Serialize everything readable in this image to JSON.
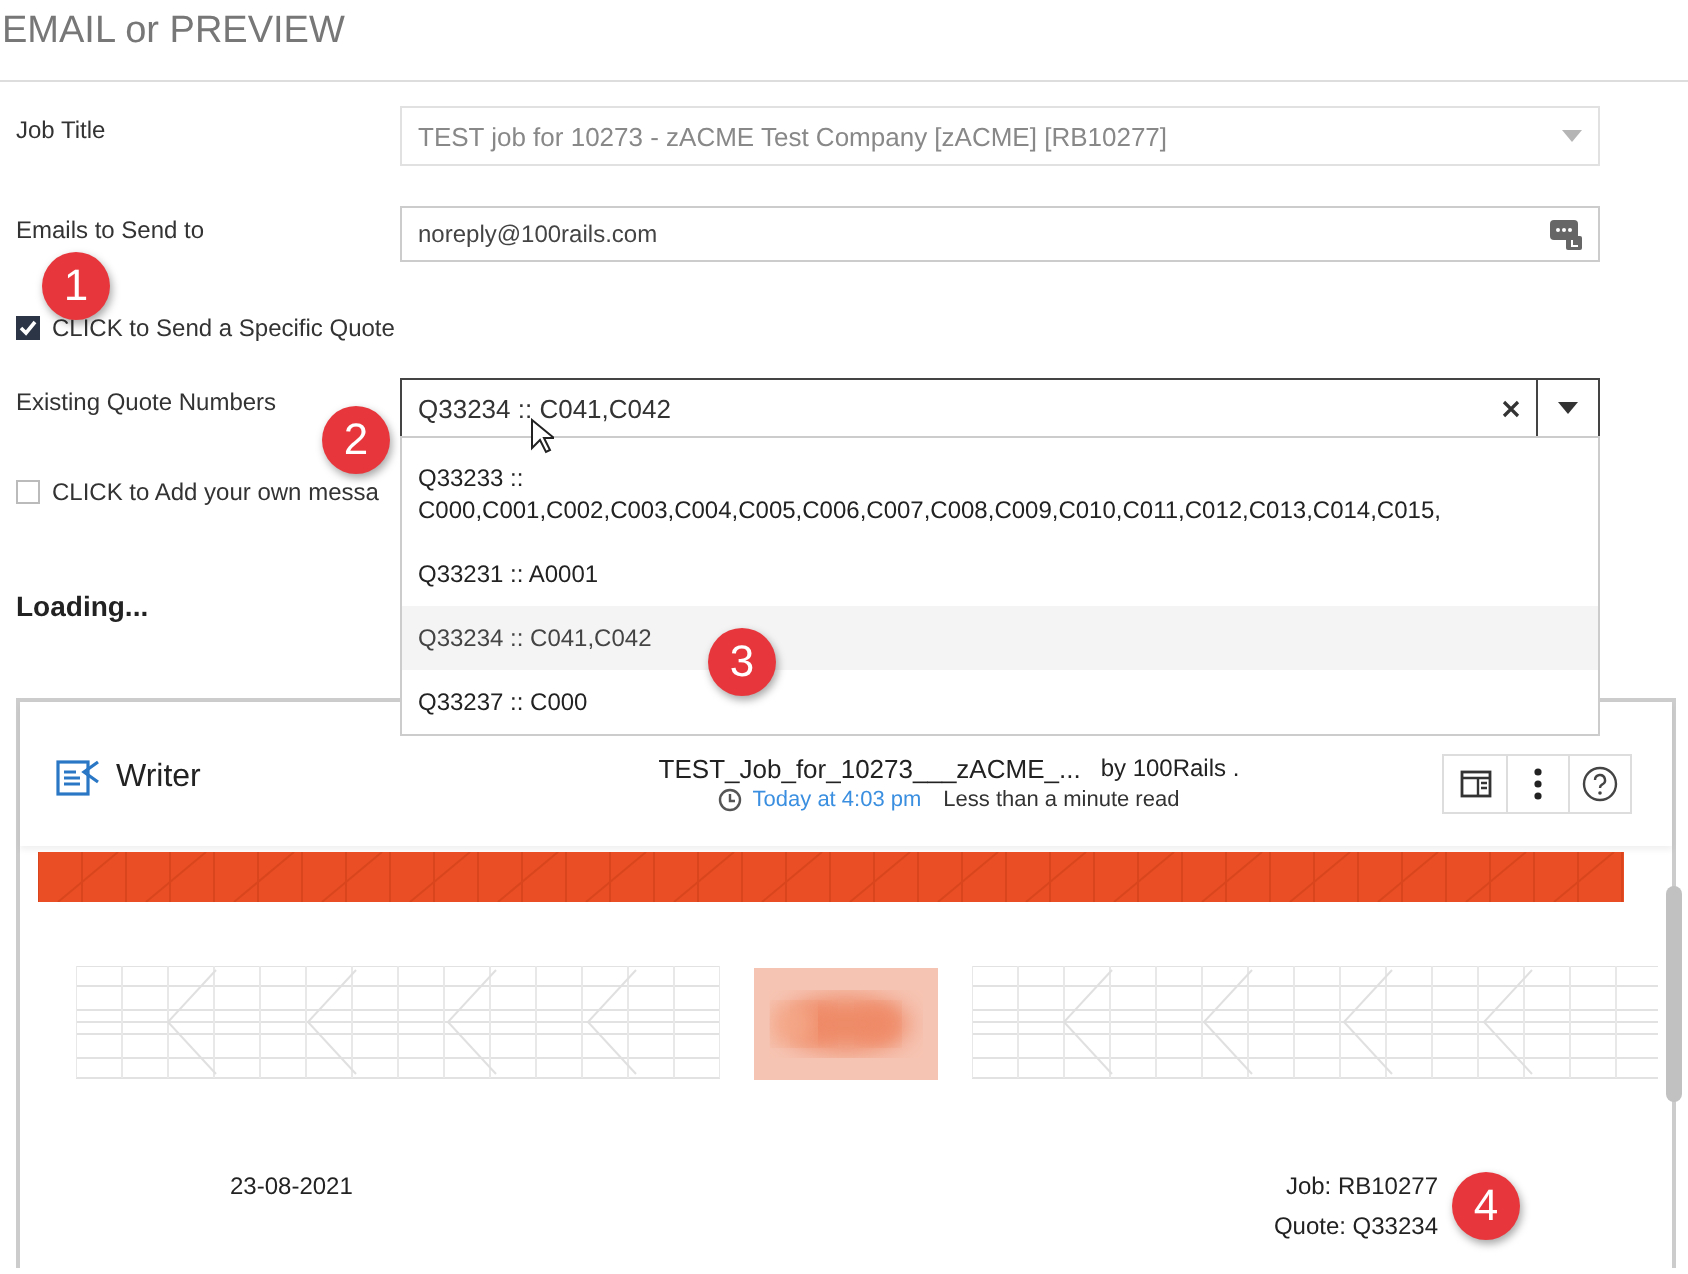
{
  "page": {
    "title": "EMAIL or PREVIEW"
  },
  "fields": [
    {
      "kind": "select",
      "label": "Job Title",
      "value": "TEST job for 10273 - zACME Test Company [zACME] [RB10277]",
      "disabled": true
    },
    {
      "kind": "email",
      "label": "Emails to Send to",
      "value": "noreply@100rails.com",
      "disabled": false
    }
  ],
  "specific_quote": {
    "label": "CLICK to Send a Specific Quote",
    "checked": true
  },
  "quote_select": {
    "label": "Existing Quote Numbers",
    "value": "Q33234 :: C041,C042",
    "expanded": true,
    "options": [
      {
        "text": "Q33233 :: C000,C001,C002,C003,C004,C005,C006,C007,C008,C009,C010,C011,C012,C013,C014,C015,",
        "selected": false
      },
      {
        "text": "Q33231 :: A0001",
        "selected": false
      },
      {
        "text": "Q33234 :: C041,C042",
        "selected": true
      },
      {
        "text": "Q33237 :: C000",
        "selected": false
      }
    ]
  },
  "own_message": {
    "label": "CLICK to Add your own messa",
    "checked": false
  },
  "status": "Loading...",
  "preview": {
    "app": "Writer",
    "doc_title": "TEST_Job_for_10273___zACME_...",
    "author": "by 100Rails .",
    "time": "Today at 4:03 pm",
    "read_time": "Less than a minute read",
    "date": "23-08-2021",
    "job": "Job: RB10277",
    "quote": "Quote: Q33234"
  },
  "annotations": [
    "1",
    "2",
    "3",
    "4"
  ]
}
